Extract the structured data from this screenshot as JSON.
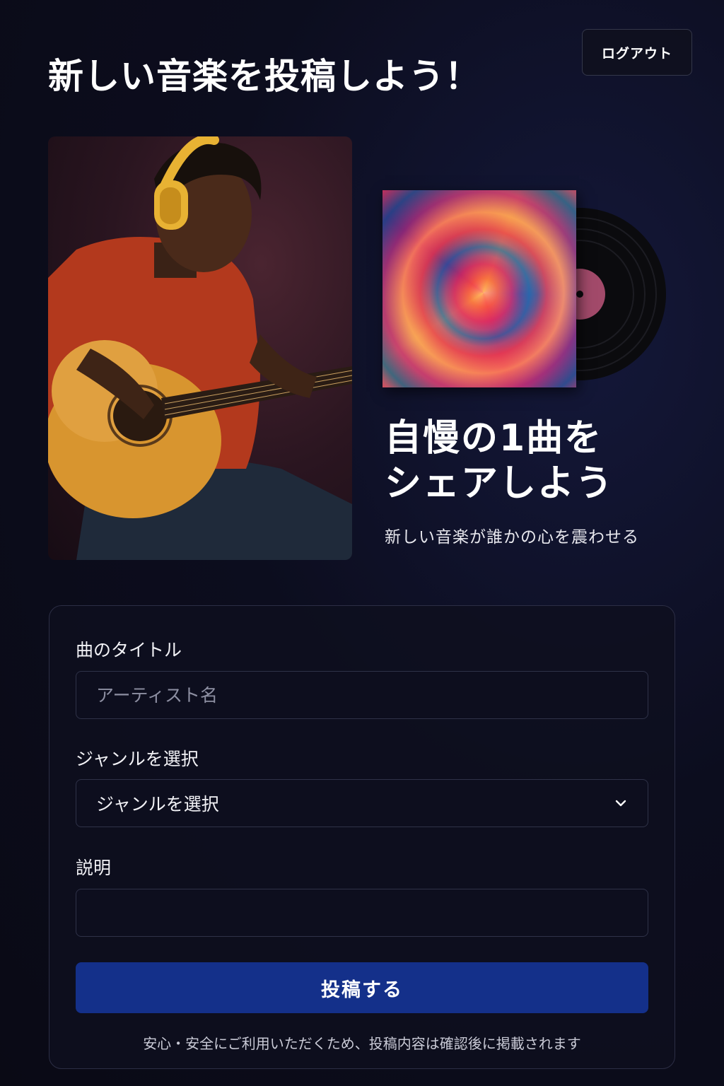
{
  "header": {
    "title": "新しい音楽を投稿しよう！",
    "logout_label": "ログアウト"
  },
  "hero": {
    "heading_line1": "自慢の1曲を",
    "heading_line2": "シェアしよう",
    "subtext": "新しい音楽が誰かの心を震わせる"
  },
  "form": {
    "title_label": "曲のタイトル",
    "artist_placeholder": "アーティスト名",
    "genre_label": "ジャンルを選択",
    "genre_selected": "ジャンルを選択",
    "description_label": "説明",
    "description_value": "",
    "submit_label": "投稿する",
    "notice": "安心・安全にご利用いただくため、投稿内容は確認後に掲載されます"
  },
  "colors": {
    "background": "#0c0d1e",
    "card_border": "#2c2e45",
    "submit": "#14308a",
    "headphones": "#e8b233"
  },
  "icons": {
    "select_chevron": "chevron-down-icon"
  }
}
